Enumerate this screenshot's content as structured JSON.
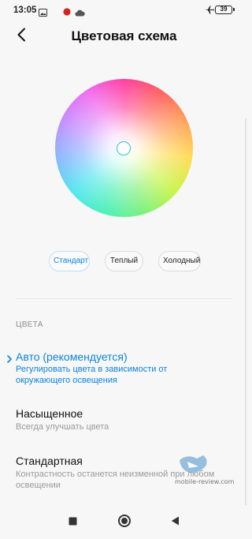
{
  "status_bar": {
    "time": "13:05",
    "battery": "39",
    "icons": [
      "gallery-icon",
      "tomato-icon",
      "cloud-icon",
      "airplane-mode-icon",
      "battery-icon"
    ]
  },
  "header": {
    "title": "Цветовая схема",
    "back_icon": "chevron-left-icon"
  },
  "color_wheel": {
    "presets": [
      {
        "label": "Стандарт",
        "selected": true
      },
      {
        "label": "Теплый",
        "selected": false
      },
      {
        "label": "Холодный",
        "selected": false
      }
    ]
  },
  "colors_section": {
    "header": "ЦВЕТА",
    "options": [
      {
        "title": "Авто (рекомендуется)",
        "subtitle": "Регулировать цвета в зависимости от окружающего освещения",
        "selected": true
      },
      {
        "title": "Насыщенное",
        "subtitle": "Всегда улучшать цвета",
        "selected": false
      },
      {
        "title": "Стандартная",
        "subtitle": "Контрастность останется неизменной при любом освещении",
        "selected": false
      }
    ]
  },
  "watermark": {
    "text": "mobile-review.com"
  },
  "nav_bar": {
    "icons": [
      "recent-apps-icon",
      "home-icon",
      "back-icon"
    ]
  },
  "theme": {
    "accent": "#0d84d9",
    "background": "#f7f7f7",
    "handle": "#2ec4c4"
  }
}
